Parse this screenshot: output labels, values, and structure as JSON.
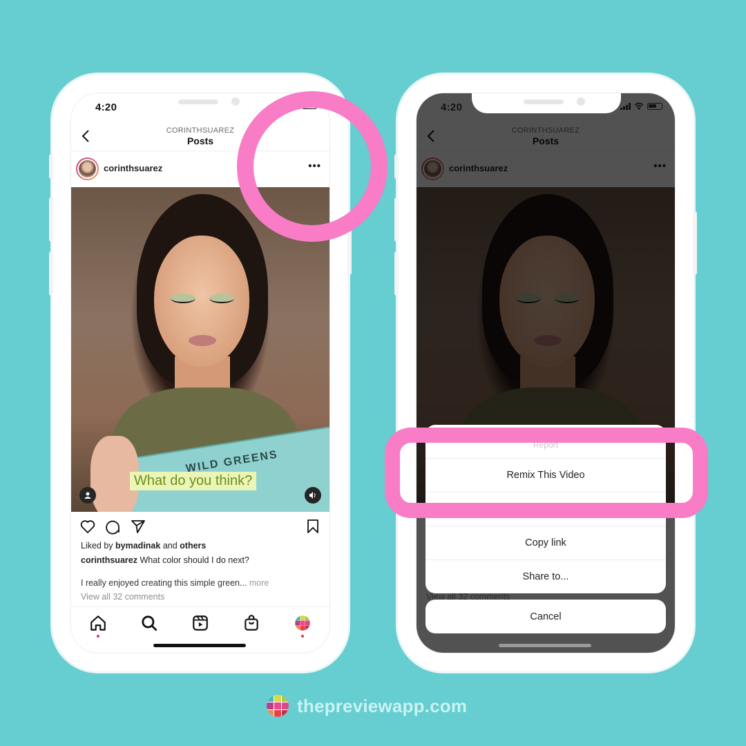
{
  "colors": {
    "background": "#66cdd0",
    "highlight": "#f87cc6",
    "like_dot": "#e1306c",
    "caption_text": "#6b8f18",
    "caption_bg": "#ecf5b8"
  },
  "left_phone": {
    "status": {
      "time": "4:20"
    },
    "nav": {
      "subtitle": "CORINTHSUAREZ",
      "title": "Posts",
      "back_icon": "chevron-left-icon"
    },
    "post": {
      "username": "corinthsuarez",
      "more_icon": "more-dots-icon",
      "media": {
        "product_text": "WILD GREENS",
        "caption_sticker": "What do you think?",
        "user_tag_icon": "user-icon",
        "sound_icon": "speaker-icon"
      },
      "actions": [
        "heart-icon",
        "comment-icon",
        "share-icon",
        "bookmark-icon"
      ],
      "likes": {
        "prefix": "Liked by ",
        "user": "bymadinak",
        "middle": " and ",
        "others": "others"
      },
      "caption": {
        "user": "corinthsuarez",
        "text": " What color should I do next?"
      },
      "caption_more": {
        "text": "I really enjoyed creating this simple green... ",
        "more": "more"
      },
      "comments_link": "View all 32 comments"
    },
    "tabbar": [
      "home-icon",
      "search-icon",
      "reels-icon",
      "shop-icon",
      "profile-icon"
    ]
  },
  "right_phone": {
    "status": {
      "time": "4:20"
    },
    "nav": {
      "subtitle": "CORINTHSUAREZ",
      "title": "Posts"
    },
    "post": {
      "username": "corinthsuarez",
      "comments_link": "View all 32 comments"
    },
    "sheet": {
      "items": [
        {
          "label": "Report"
        },
        {
          "label": "Remix This Video"
        },
        {
          "label": ""
        },
        {
          "label": "Copy link"
        },
        {
          "label": "Share to..."
        }
      ],
      "cancel": "Cancel"
    }
  },
  "footer": {
    "brand": "thepreviewapp.com"
  }
}
